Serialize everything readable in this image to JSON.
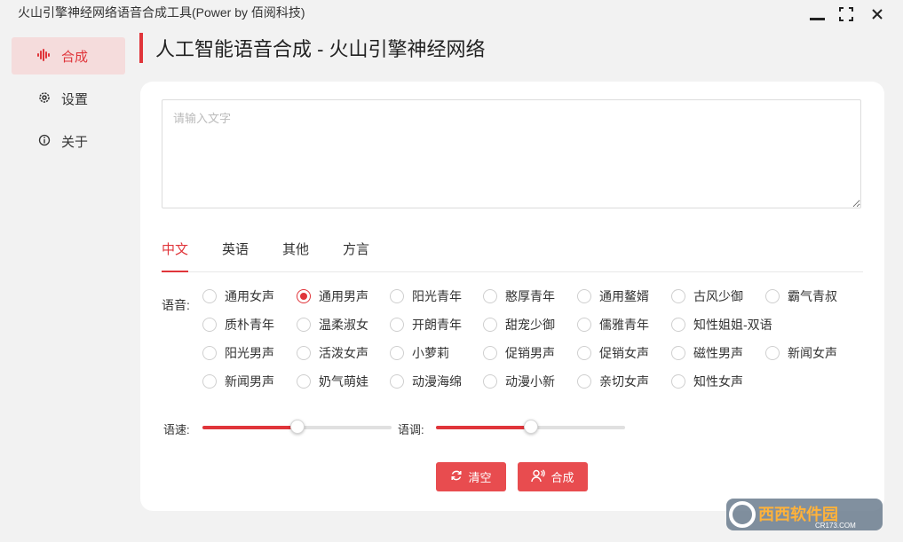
{
  "window": {
    "title": "火山引擎神经网络语音合成工具(Power by 佰阅科技)",
    "minimize_icon": "minimize-icon",
    "maximize_icon": "maximize-icon",
    "close_icon": "close-icon"
  },
  "sidebar": {
    "items": [
      {
        "label": "合成",
        "icon": "waveform-icon",
        "active": true
      },
      {
        "label": "设置",
        "icon": "gear-icon",
        "active": false
      },
      {
        "label": "关于",
        "icon": "info-icon",
        "active": false
      }
    ]
  },
  "header": {
    "title": "人工智能语音合成 - 火山引擎神经网络"
  },
  "input": {
    "placeholder": "请输入文字",
    "value": ""
  },
  "tabs": [
    {
      "label": "中文",
      "active": true
    },
    {
      "label": "英语",
      "active": false
    },
    {
      "label": "其他",
      "active": false
    },
    {
      "label": "方言",
      "active": false
    }
  ],
  "voice": {
    "label": "语音:",
    "selected": "通用男声",
    "options": [
      "通用女声",
      "通用男声",
      "阳光青年",
      "憨厚青年",
      "通用鳌婿",
      "古风少御",
      "霸气青叔",
      "质朴青年",
      "温柔淑女",
      "开朗青年",
      "甜宠少御",
      "儒雅青年",
      "知性姐姐-双语",
      "阳光男声",
      "活泼女声",
      "小萝莉",
      "促销男声",
      "促销女声",
      "磁性男声",
      "新闻女声",
      "新闻男声",
      "奶气萌娃",
      "动漫海绵",
      "动漫小新",
      "亲切女声",
      "知性女声"
    ]
  },
  "speed": {
    "label": "语速:",
    "value": 0.5
  },
  "pitch": {
    "label": "语调:",
    "value": 0.5
  },
  "buttons": {
    "clear": {
      "label": "清空",
      "icon": "refresh-icon"
    },
    "synthesize": {
      "label": "合成",
      "icon": "speaker-person-icon"
    }
  },
  "watermark": {
    "text": "西西软件园",
    "sub": "CR173.COM"
  },
  "colors": {
    "accent": "#e0353a",
    "active_bg": "#f5dcdc",
    "button": "#e84c4f"
  }
}
